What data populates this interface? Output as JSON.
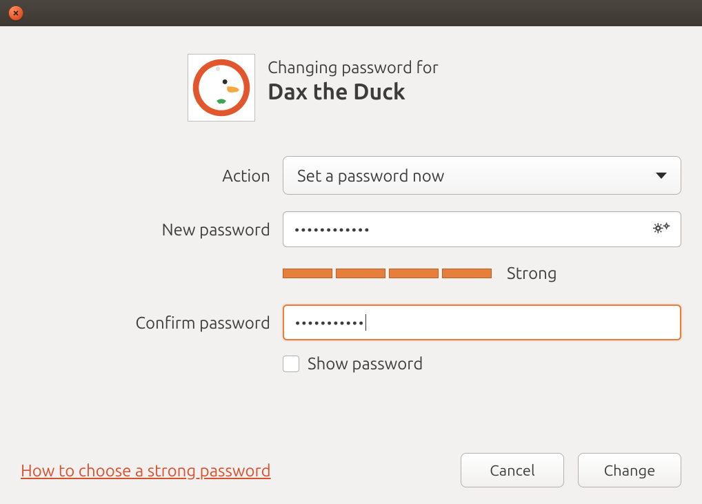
{
  "header": {
    "subtitle": "Changing password for",
    "username": "Dax the Duck"
  },
  "labels": {
    "action": "Action",
    "new_password": "New password",
    "confirm_password": "Confirm password",
    "show_password": "Show password"
  },
  "fields": {
    "action_value": "Set a password now",
    "new_password_value": "••••••••••••",
    "confirm_password_value": "•••••••••••"
  },
  "strength": {
    "label": "Strong",
    "segments": 4
  },
  "footer": {
    "help_link": "How to choose a strong password",
    "cancel": "Cancel",
    "change": "Change"
  },
  "colors": {
    "accent": "#e67e3c",
    "link": "#d7512c"
  }
}
